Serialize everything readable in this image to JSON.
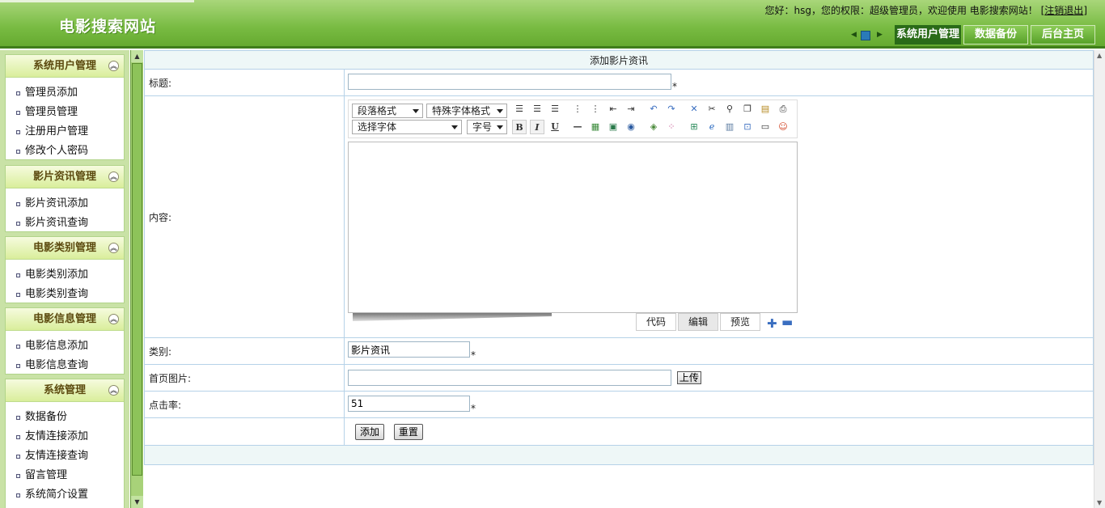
{
  "header": {
    "site_title": "电影搜索网站",
    "welcome_text": "您好：hsg，您的权限：超级管理员，欢迎使用 电影搜索网站！",
    "logout_bracket_open": "[",
    "logout_label": "注销退出",
    "logout_bracket_close": "]",
    "tabs": [
      "系统用户管理",
      "数据备份",
      "后台主页"
    ]
  },
  "sidebar": {
    "groups": [
      {
        "title": "系统用户管理",
        "items": [
          "管理员添加",
          "管理员管理",
          "注册用户管理",
          "修改个人密码"
        ]
      },
      {
        "title": "影片资讯管理",
        "items": [
          "影片资讯添加",
          "影片资讯查询"
        ]
      },
      {
        "title": "电影类别管理",
        "items": [
          "电影类别添加",
          "电影类别查询"
        ]
      },
      {
        "title": "电影信息管理",
        "items": [
          "电影信息添加",
          "电影信息查询"
        ]
      },
      {
        "title": "系统管理",
        "items": [
          "数据备份",
          "友情连接添加",
          "友情连接查询",
          "留言管理",
          "系统简介设置"
        ]
      }
    ]
  },
  "form": {
    "caption": "添加影片资讯",
    "title_label": "标题:",
    "title_value": "",
    "content_label": "内容:",
    "category_label": "类别:",
    "category_value": "影片资讯",
    "image_label": "首页图片:",
    "image_value": "",
    "upload_label": "上传",
    "clicks_label": "点击率:",
    "clicks_value": "51",
    "required_mark": "*",
    "submit_label": "添加",
    "reset_label": "重置"
  },
  "editor": {
    "paragraph_select": "段落格式",
    "special_font_select": "特殊字体格式",
    "font_select": "选择字体",
    "size_select": "字号",
    "bold": "B",
    "italic": "I",
    "underline": "U",
    "mode_code": "代码",
    "mode_edit": "编辑",
    "mode_preview": "预览"
  }
}
